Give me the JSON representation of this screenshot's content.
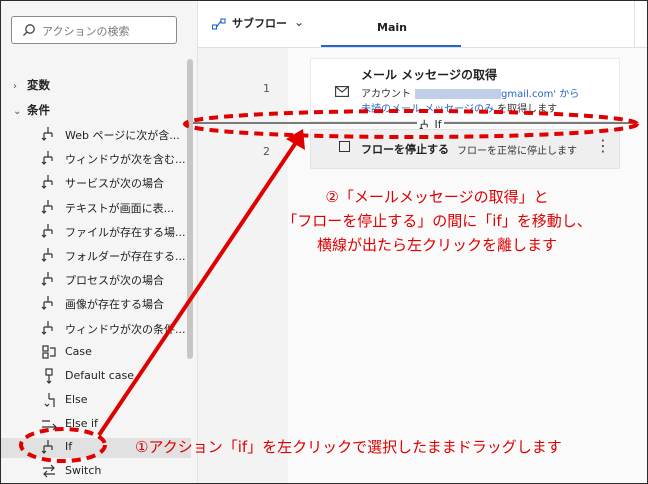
{
  "search": {
    "placeholder": "アクションの検索"
  },
  "groups": {
    "vars": "変数",
    "cond": "条件"
  },
  "actions": [
    "Web ページに次が含...",
    "ウィンドウが次を含む...",
    "サービスが次の場合",
    "テキストが画面に表...",
    "ファイルが存在する場...",
    "フォルダーが存在する...",
    "プロセスが次の場合",
    "画像が存在する場合",
    "ウィンドウが次の条件...",
    "Case",
    "Default case",
    "Else",
    "Else if",
    "If",
    "Switch"
  ],
  "topbar": {
    "subflow": "サブフロー",
    "tab_main": "Main"
  },
  "lines": [
    "1",
    "2"
  ],
  "step1": {
    "title": "メール メッセージの取得",
    "account_label": "アカウント",
    "account_suffix": "gmail.com' から",
    "unread_prefix": "未読のメール メッセージのみ",
    "unread_suffix": "を取得します"
  },
  "drop": {
    "label": "If"
  },
  "step2": {
    "title": "フローを停止する",
    "desc": "フローを正常に停止します"
  },
  "annotations": {
    "a1": "①アクション「if」を左クリックで選択したままドラッグします",
    "a2_line1": "②「メールメッセージの取得」と",
    "a2_line2": "「フローを停止する」の間に「if」を移動し、",
    "a2_line3": "横線が出たら左クリックを離します"
  },
  "colors": {
    "annotation": "#e00000",
    "accent": "#2366c9"
  }
}
